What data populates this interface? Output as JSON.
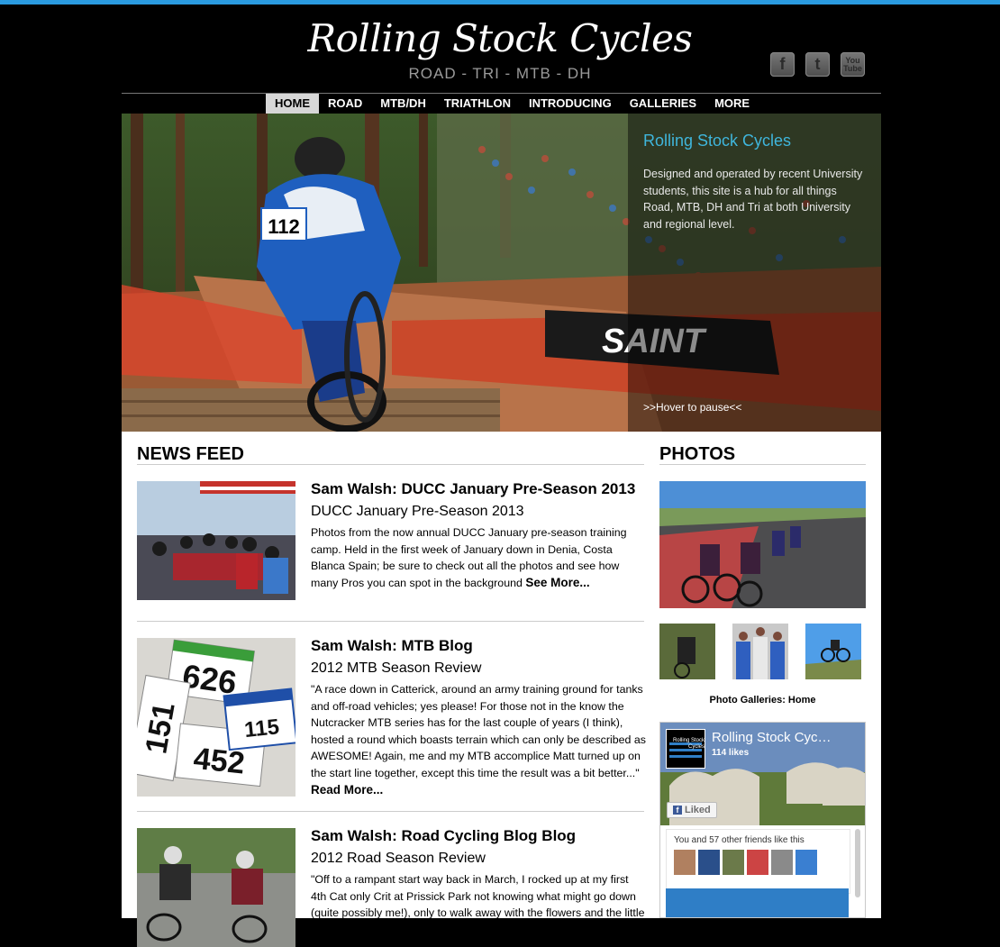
{
  "header": {
    "site_title": "Rolling Stock Cycles",
    "tagline": "ROAD - TRI - MTB - DH",
    "social": [
      {
        "icon": "facebook-icon",
        "glyph": "f"
      },
      {
        "icon": "twitter-icon",
        "glyph": "t"
      },
      {
        "icon": "youtube-icon",
        "glyph": "You\nTube"
      }
    ]
  },
  "nav": {
    "items": [
      "HOME",
      "ROAD",
      "MTB/DH",
      "TRIATHLON",
      "INTRODUCING",
      "GALLERIES",
      "MORE"
    ],
    "active": "HOME"
  },
  "hero": {
    "title": "Rolling Stock Cycles",
    "description": "Designed and operated by recent University students, this site is a hub for all things Road, MTB, DH and Tri at both University and regional level.",
    "pause_hint": ">>Hover to pause<<",
    "bib_number": "112",
    "banner_text": "SAINT"
  },
  "news": {
    "heading": "NEWS FEED",
    "posts": [
      {
        "title": "Sam Walsh: DUCC January Pre-Season 2013",
        "subtitle": "DUCC January Pre-Season 2013",
        "text": "Photos from the now annual DUCC January pre-season training camp. Held in the first week of January down in Denia, Costa Blanca Spain; be sure to check out all the photos and see how many Pros you can spot in the background",
        "more": "See More..."
      },
      {
        "title": "Sam Walsh: MTB Blog",
        "subtitle": "2012 MTB Season Review",
        "text": "\"A race down in Catterick, around an army training ground for tanks and off-road vehicles; yes please! For those not in the know the Nutcracker MTB series has for the last couple of years (I think), hosted a round which boasts terrain which can only be described as AWESOME! Again, me and my MTB accomplice Matt turned up on the start line together, except this time the result was a bit better...\"",
        "more": "Read More...",
        "plates": [
          "626",
          "151",
          "452",
          "115"
        ]
      },
      {
        "title": "Sam Walsh: Road Cycling Blog Blog",
        "subtitle": "2012 Road Season Review",
        "text": "\"Off to a rampant start way back in March, I rocked up at my first 4th Cat only Crit at Prissick Park not knowing what might go down (quite possibly me!), only to walk away with the flowers and the little"
      }
    ]
  },
  "photos": {
    "heading": "PHOTOS",
    "gallery_link": "Photo Galleries: Home"
  },
  "facebook": {
    "page_name": "Rolling Stock Cyc…",
    "likes": "114 likes",
    "liked_button": "Liked",
    "friends_text": "You and 57 other friends like this",
    "logo_text": "Rolling Stock Cycles"
  },
  "colors": {
    "accent_blue": "#2a9be0",
    "hero_title": "#3fb6dc",
    "nav_active_bg": "#d7d7d7",
    "facebook_blue": "#3b5998"
  }
}
